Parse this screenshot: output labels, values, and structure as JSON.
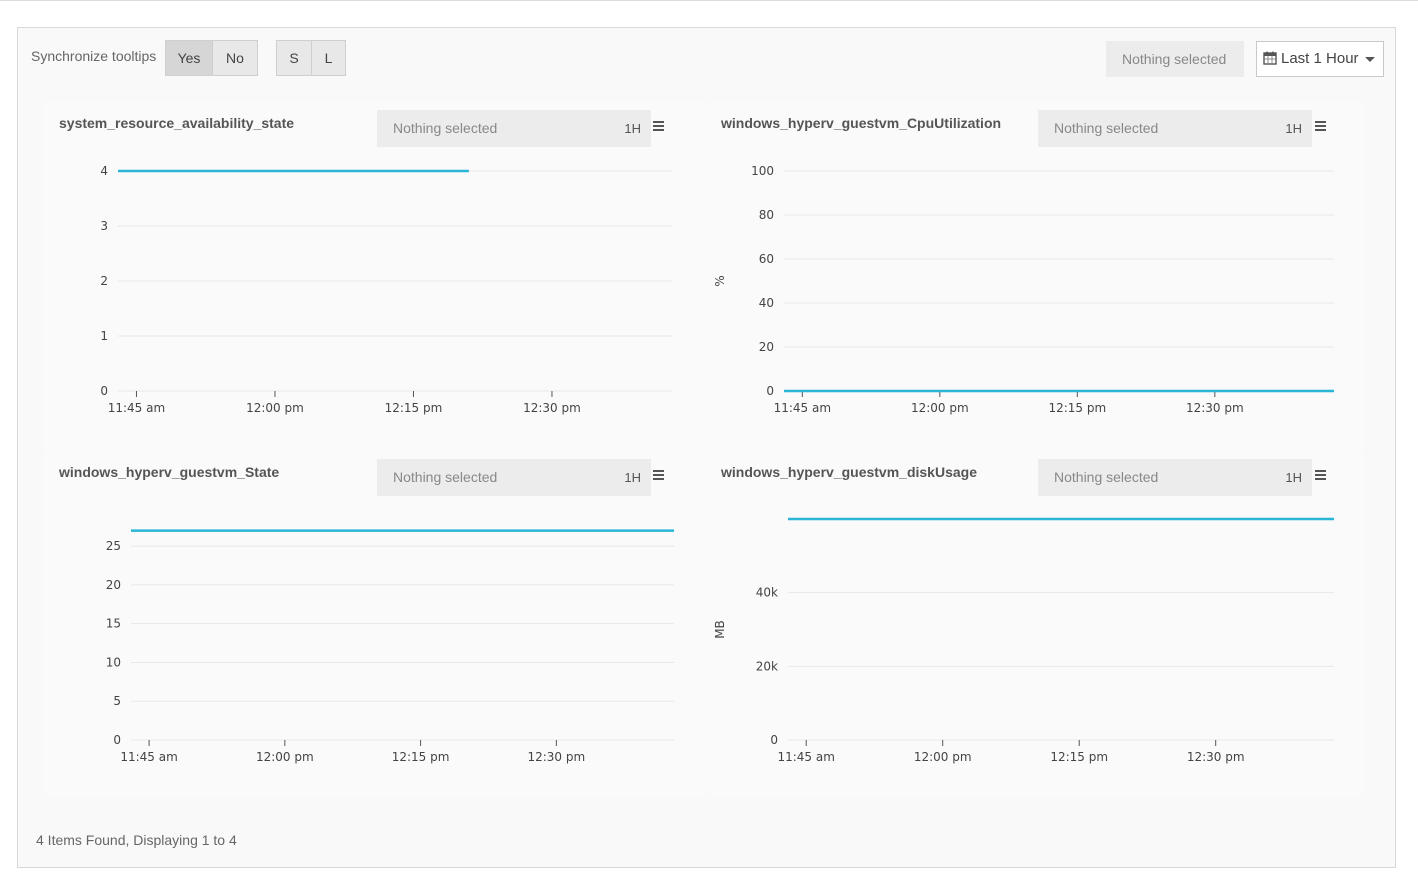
{
  "toolbar": {
    "sync_label": "Synchronize tooltips",
    "yes_label": "Yes",
    "no_label": "No",
    "s_label": "S",
    "l_label": "L",
    "filter_placeholder": "Nothing selected",
    "timerange_label": "Last 1 Hour",
    "calendar_icon": "calendar-icon"
  },
  "footer": {
    "text": "4 Items Found, Displaying 1 to 4"
  },
  "colors": {
    "series": "#29b6d6",
    "grid": "#e8e8e8",
    "axis": "#555555"
  },
  "cards": [
    {
      "select_text": "Nothing selected",
      "range": "1H"
    },
    {
      "select_text": "Nothing selected",
      "range": "1H"
    },
    {
      "select_text": "Nothing selected",
      "range": "1H"
    },
    {
      "select_text": "Nothing selected",
      "range": "1H"
    }
  ],
  "chart_data": [
    {
      "type": "line",
      "title": "system_resource_availability_state",
      "xlabel": "",
      "ylabel": "",
      "x_ticks": [
        "11:45 am",
        "12:00 pm",
        "12:15 pm",
        "12:30 pm"
      ],
      "y_ticks": [
        "0",
        "1",
        "2",
        "3",
        "4"
      ],
      "ylim": [
        0,
        4
      ],
      "xlim": [
        "11:43",
        "12:43"
      ],
      "series": [
        {
          "x": [
            "11:43",
            "12:21"
          ],
          "values": [
            4,
            4
          ]
        }
      ],
      "grid": true
    },
    {
      "type": "line",
      "title": "windows_hyperv_guestvm_CpuUtilization",
      "xlabel": "",
      "ylabel": "%",
      "x_ticks": [
        "11:45 am",
        "12:00 pm",
        "12:15 pm",
        "12:30 pm"
      ],
      "y_ticks": [
        "0",
        "20",
        "40",
        "60",
        "80",
        "100"
      ],
      "ylim": [
        0,
        100
      ],
      "xlim": [
        "11:43",
        "12:43"
      ],
      "series": [
        {
          "x": [
            "11:43",
            "12:43"
          ],
          "values": [
            0,
            0
          ]
        }
      ],
      "grid": true
    },
    {
      "type": "line",
      "title": "windows_hyperv_guestvm_State",
      "xlabel": "",
      "ylabel": "",
      "x_ticks": [
        "11:45 am",
        "12:00 pm",
        "12:15 pm",
        "12:30 pm"
      ],
      "y_ticks": [
        "0",
        "5",
        "10",
        "15",
        "20",
        "25"
      ],
      "ylim": [
        0,
        28.5
      ],
      "xlim": [
        "11:43",
        "12:43"
      ],
      "series": [
        {
          "x": [
            "11:43",
            "12:43"
          ],
          "values": [
            27,
            27
          ]
        }
      ],
      "grid": true
    },
    {
      "type": "line",
      "title": "windows_hyperv_guestvm_diskUsage",
      "xlabel": "",
      "ylabel": "MB",
      "x_ticks": [
        "11:45 am",
        "12:00 pm",
        "12:15 pm",
        "12:30 pm"
      ],
      "y_ticks": [
        "0",
        "20k",
        "40k"
      ],
      "ylim": [
        0,
        60000
      ],
      "xlim": [
        "11:43",
        "12:43"
      ],
      "series": [
        {
          "x": [
            "11:43",
            "12:43"
          ],
          "values": [
            60000,
            60000
          ]
        }
      ],
      "grid": true
    }
  ]
}
